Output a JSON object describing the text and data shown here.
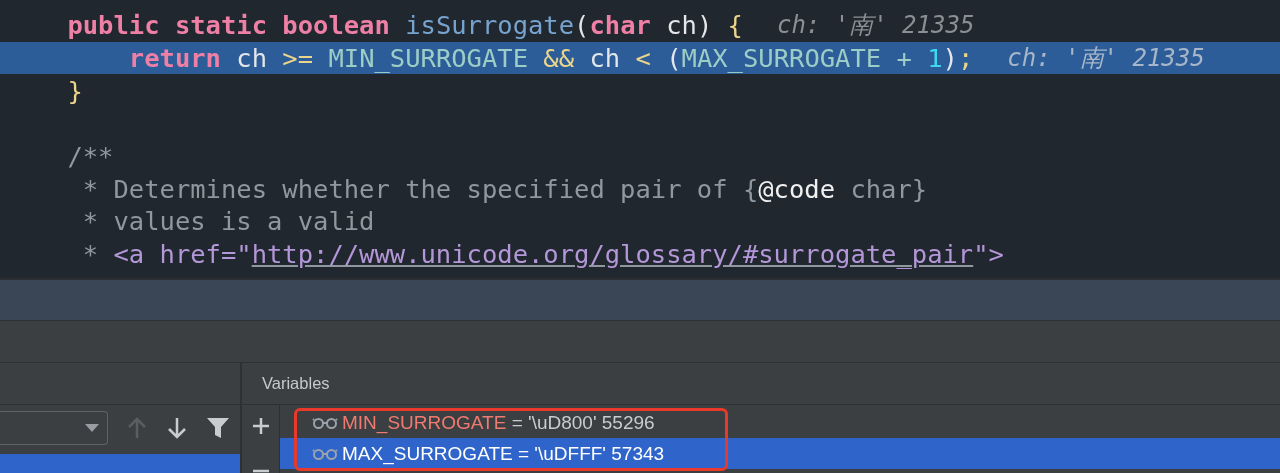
{
  "editor": {
    "lines": [
      {
        "kind": "code",
        "tokens": [
          {
            "text": "    public static boolean ",
            "kind": "keyword"
          },
          {
            "text": "isSurrogate",
            "kind": "method"
          },
          {
            "text": "(",
            "kind": "plain"
          },
          {
            "text": "char ",
            "kind": "keyword"
          },
          {
            "text": "ch) ",
            "kind": "plain"
          },
          {
            "text": "{",
            "kind": "brace"
          }
        ],
        "hint": "ch: '南' 21335"
      },
      {
        "kind": "current",
        "tokens": [
          {
            "text": "        return ",
            "kind": "keyword"
          },
          {
            "text": "ch ",
            "kind": "plain"
          },
          {
            "text": ">= ",
            "kind": "brace"
          },
          {
            "text": "MIN_SURROGATE ",
            "kind": "constant"
          },
          {
            "text": "&& ",
            "kind": "brace"
          },
          {
            "text": "ch ",
            "kind": "plain"
          },
          {
            "text": "< ",
            "kind": "brace"
          },
          {
            "text": "(",
            "kind": "plain"
          },
          {
            "text": "MAX_SURROGATE + ",
            "kind": "constant"
          },
          {
            "text": "1",
            "kind": "number"
          },
          {
            "text": ")",
            "kind": "plain"
          },
          {
            "text": ";",
            "kind": "brace"
          }
        ],
        "hint": "ch: '南' 21335"
      },
      {
        "kind": "code",
        "tokens": [
          {
            "text": "    }",
            "kind": "brace"
          }
        ]
      },
      {
        "kind": "blank"
      },
      {
        "kind": "code",
        "tokens": [
          {
            "text": "    /**",
            "kind": "comment"
          }
        ]
      },
      {
        "kind": "code",
        "tokens": [
          {
            "text": "     * Determines whether the specified pair of {",
            "kind": "comment"
          },
          {
            "text": "@code",
            "kind": "tag"
          },
          {
            "text": " char}",
            "kind": "comment"
          }
        ]
      },
      {
        "kind": "code",
        "tokens": [
          {
            "text": "     * values is a valid",
            "kind": "comment"
          }
        ]
      },
      {
        "kind": "code",
        "tokens": [
          {
            "text": "     * ",
            "kind": "comment"
          },
          {
            "text": "<a href=\"",
            "kind": "html"
          },
          {
            "text": "http://www.unicode.org/glossary/#surrogate_pair",
            "kind": "link"
          },
          {
            "text": "\">",
            "kind": "html"
          }
        ]
      }
    ]
  },
  "debugger": {
    "variables_title": "Variables",
    "frames": [
      {
        "selected": true
      }
    ],
    "watches": [
      {
        "name": "MIN_SURROGATE",
        "value": "= '\\uD800' 55296",
        "selected": false
      },
      {
        "name": "MAX_SURROGATE",
        "value": "= '\\uDFFF' 57343",
        "selected": true
      }
    ]
  }
}
